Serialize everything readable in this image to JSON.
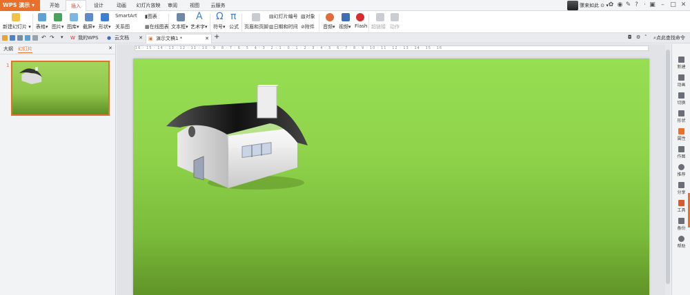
{
  "app": {
    "name": "WPS 演示"
  },
  "menu": [
    "开始",
    "插入",
    "设计",
    "动画",
    "幻灯片放映",
    "审阅",
    "视图",
    "云服务"
  ],
  "user": {
    "name": "骤来如此"
  },
  "ribbon": {
    "new_slide": "新建幻灯片",
    "table": "表格",
    "picture": "图片",
    "gallery": "图库",
    "screenshot": "截屏",
    "shapes": "形状",
    "chart": "图表",
    "smartart": "SmartArt",
    "relation": "关系图",
    "online_chart": "在线图表",
    "textbox": "文本框",
    "wordart": "艺术字",
    "symbol": "符号",
    "formula": "公式",
    "header_footer": "页眉和页脚",
    "slide_number": "幻灯片编号",
    "object": "对象",
    "datetime": "日期和时间",
    "attachment": "附件",
    "audio": "音频",
    "video": "视频",
    "flash": "Flash",
    "hyperlink": "超链接",
    "action": "动作"
  },
  "tabs": [
    {
      "label": "我的WPS"
    },
    {
      "label": "云文档"
    },
    {
      "label": "演示文稿1 *"
    }
  ],
  "search": {
    "placeholder": "点此查找命令"
  },
  "left_panel": {
    "tab_outline": "大纲",
    "tab_slides": "幻灯片",
    "slide_number": "1"
  },
  "ruler": {
    "ticks": "16 · 15 · 14 · 13 · 12 · 11 · 10 · 9 · 8 · 7 · 6 · 5 · 4 · 3 · 2 · 1 · 0 · 1 · 2 · 3 · 4 · 5 · 6 · 7 · 8 · 9 · 10 · 11 · 12 · 13 · 14 · 15 · 16"
  },
  "right_panel": [
    "新建",
    "动画",
    "切换",
    "形状",
    "属性",
    "作图",
    "推荐",
    "分享",
    "工具",
    "备份",
    "帮助"
  ],
  "colors": {
    "accent": "#e8702a",
    "slide_green": "#8fd34a"
  }
}
